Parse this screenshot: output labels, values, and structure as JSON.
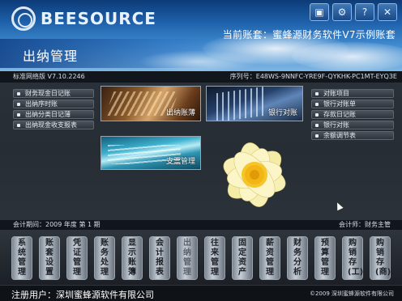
{
  "brand": {
    "name": "BEESOURCE"
  },
  "top_icons": [
    "window-icon",
    "gear-icon",
    "help-icon",
    "close-icon"
  ],
  "header": {
    "account_label": "当前账套：蜜蜂源财务软件V7示例账套",
    "module_title": "出纳管理"
  },
  "info": {
    "version": "标准网络版 V7.10.2246",
    "serial": "序列号：E48WS-9NNFC-YRE9F-QYKHK-PC1MT-EYQ3E"
  },
  "left_menu": [
    "财务现金日记账",
    "出纳序时账",
    "出纳分类日记薄",
    "出纳现金收支报表"
  ],
  "right_menu": [
    "对账项目",
    "银行对账单",
    "存款日记账",
    "银行对账",
    "余额调节表"
  ],
  "tiles": {
    "cashier_book": "出纳账薄",
    "bank_reconcile": "银行对账",
    "check_manage": "支票管理"
  },
  "status": {
    "period": "会计期间：2009 年度  第 1 期",
    "accountant": "会计师：财务主管"
  },
  "modules": [
    {
      "label": "系统管理",
      "enabled": true
    },
    {
      "label": "账套设置",
      "enabled": true
    },
    {
      "label": "凭证管理",
      "enabled": true
    },
    {
      "label": "账务处理",
      "enabled": true
    },
    {
      "label": "显示账簿",
      "enabled": true
    },
    {
      "label": "会计报表",
      "enabled": true
    },
    {
      "label": "出纳管理",
      "enabled": false
    },
    {
      "label": "往来管理",
      "enabled": true
    },
    {
      "label": "固定资产",
      "enabled": true
    },
    {
      "label": "薪资管理",
      "enabled": true
    },
    {
      "label": "财务分析",
      "enabled": true
    },
    {
      "label": "预算管理",
      "enabled": true
    },
    {
      "label": "购销存(工)",
      "enabled": true
    },
    {
      "label": "购销存(商)",
      "enabled": true
    }
  ],
  "footer": {
    "registered_user": "注册用户：深圳蜜蜂源软件有限公司",
    "copyright": "©2009 深圳蜜蜂源软件有限公司"
  }
}
